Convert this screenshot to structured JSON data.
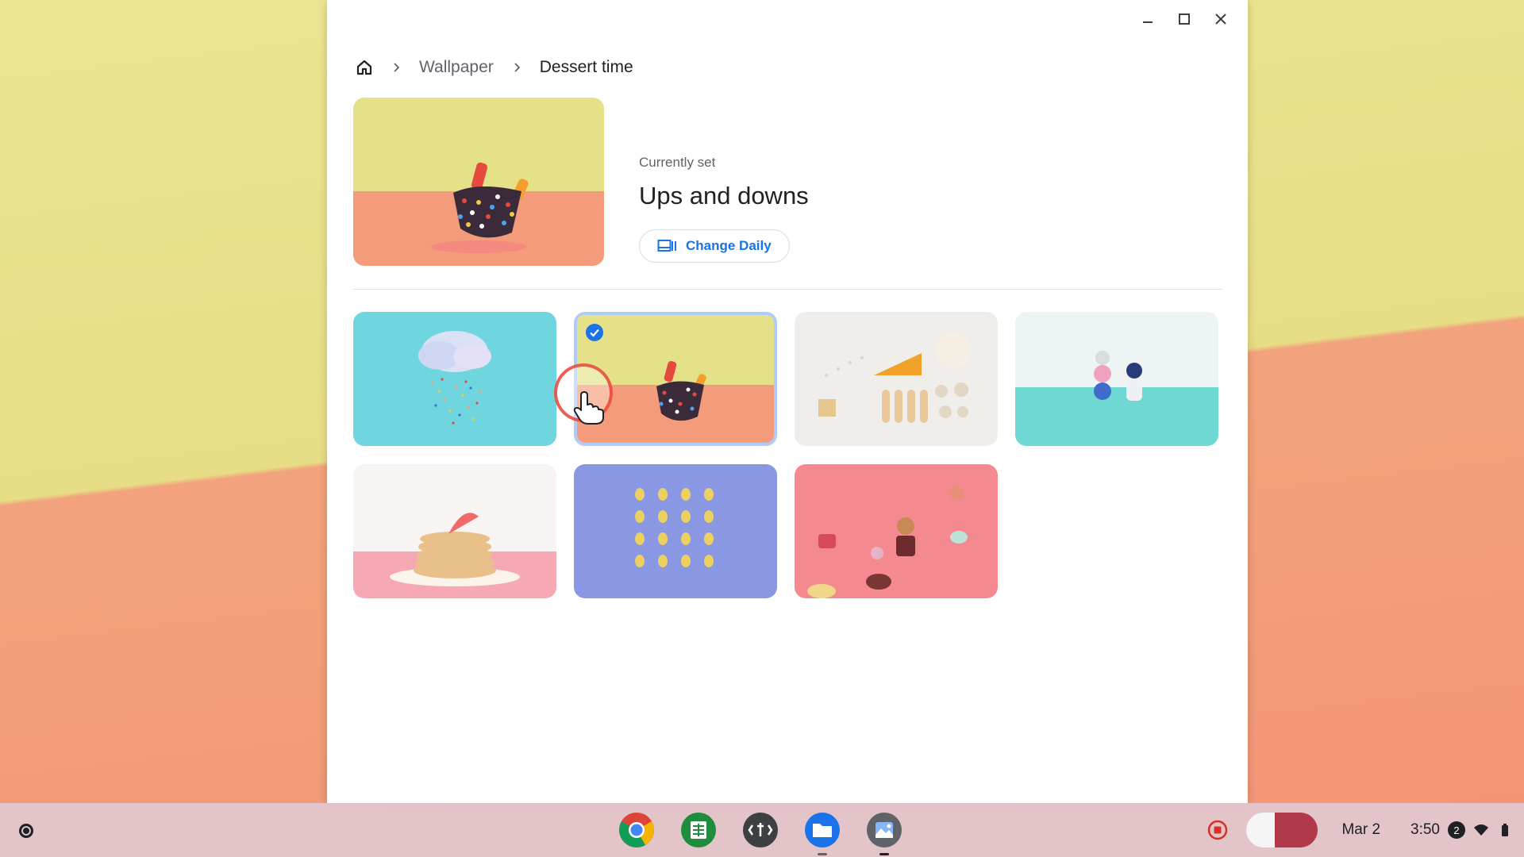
{
  "window": {
    "controls": {
      "minimize": "minimize-icon",
      "maximize": "maximize-icon",
      "close": "close-icon"
    }
  },
  "breadcrumb": {
    "home_icon": "home-icon",
    "items": [
      "Wallpaper",
      "Dessert time"
    ]
  },
  "current": {
    "label": "Currently set",
    "title": "Ups and downs",
    "change_daily": "Change Daily"
  },
  "wallpapers": [
    {
      "art": "cloud-sprinkles",
      "selected": false
    },
    {
      "art": "sprinkle-bowl",
      "selected": true
    },
    {
      "art": "baking-ingredients",
      "selected": false
    },
    {
      "art": "stacked-candies",
      "selected": false
    },
    {
      "art": "pancakes",
      "selected": false
    },
    {
      "art": "macaron-grid",
      "selected": false
    },
    {
      "art": "macarons-pink",
      "selected": false
    }
  ],
  "shelf": {
    "apps": [
      "chrome",
      "sheets",
      "terminal",
      "files",
      "wallpaper"
    ],
    "date": "Mar 2",
    "time": "3:50",
    "notification_count": "2"
  },
  "colors": {
    "accent": "#1a73e8",
    "selection_border": "#aecbfa"
  }
}
